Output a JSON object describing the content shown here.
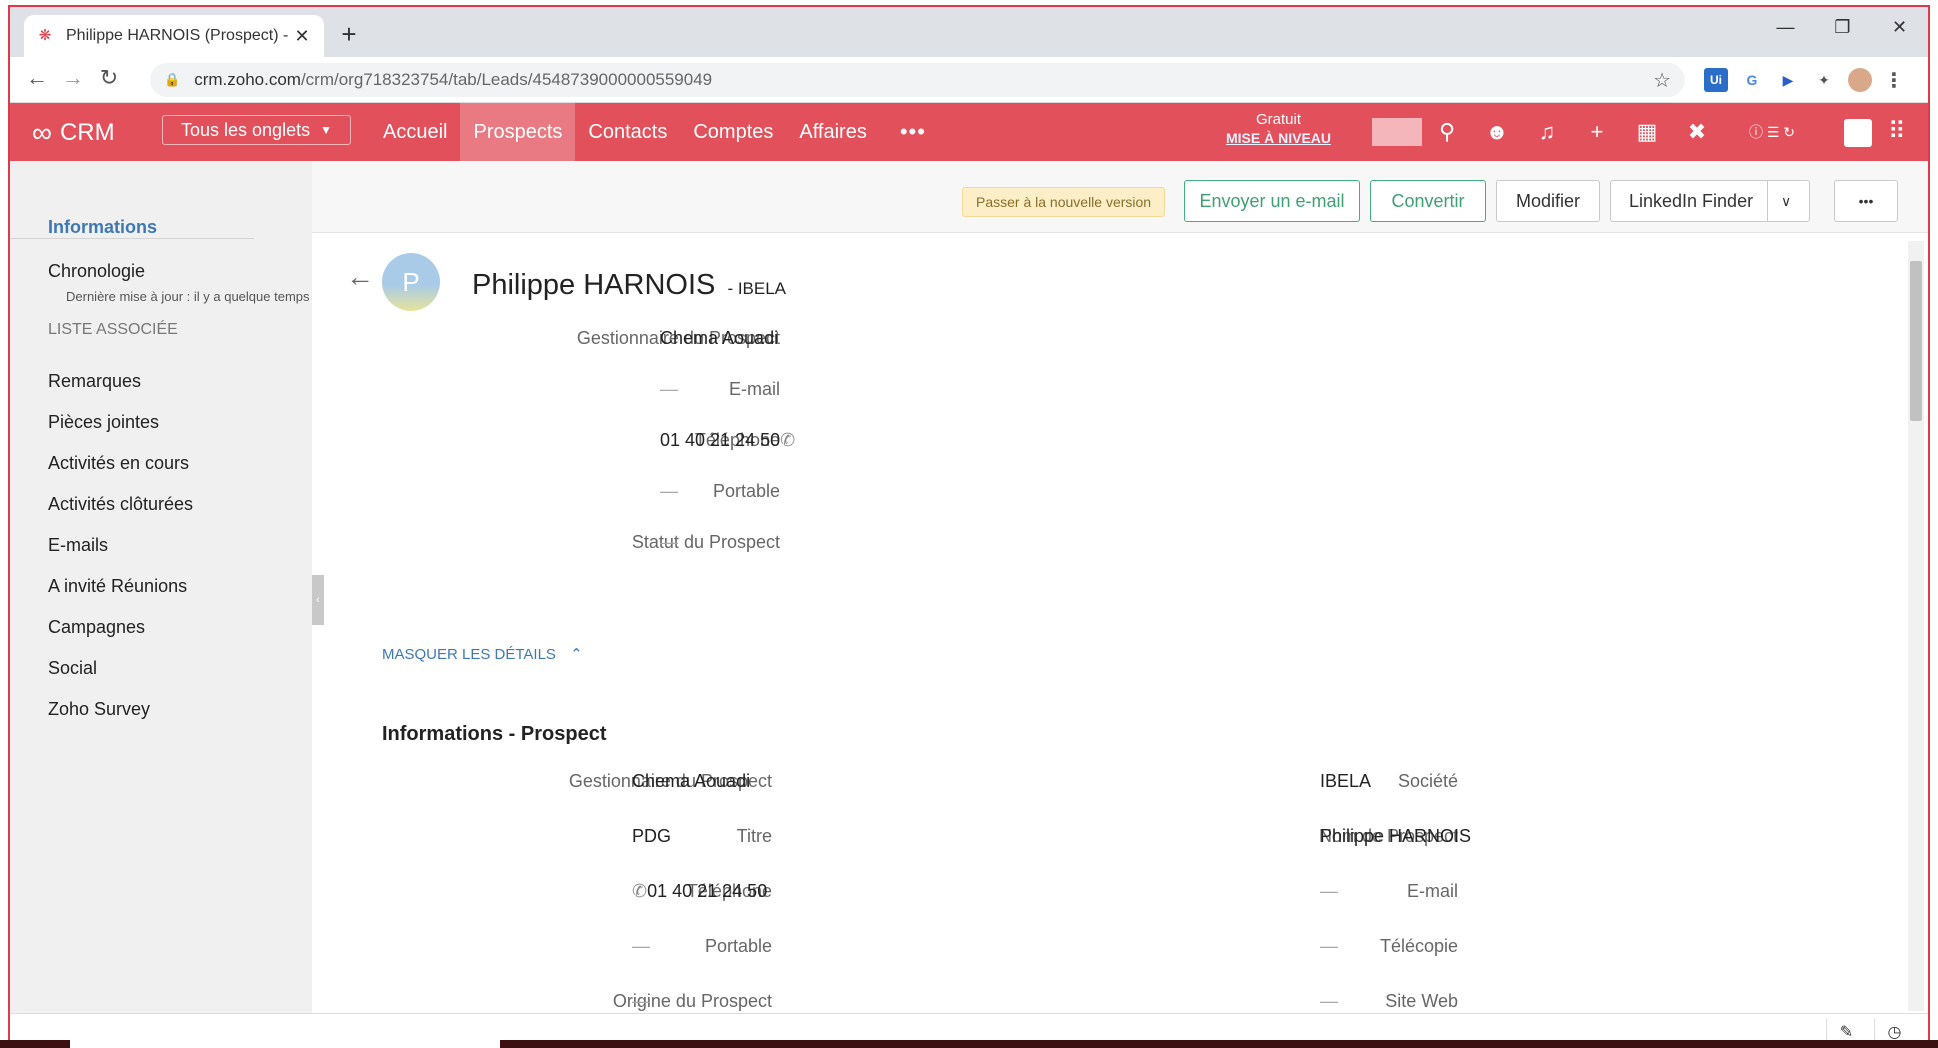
{
  "browser": {
    "tab_title": "Philippe HARNOIS (Prospect) - Zoho CRM",
    "url_host": "crm.zoho.com",
    "url_path": "/crm/org718323754/tab/Leads/4548739000000559049"
  },
  "crm": {
    "brand": "CRM",
    "all_tabs": "Tous les onglets",
    "nav": [
      "Accueil",
      "Prospects",
      "Contacts",
      "Comptes",
      "Affaires"
    ],
    "plan": "Gratuit",
    "upgrade": "MISE À NIVEAU"
  },
  "sidebar": {
    "informations": "Informations",
    "chronologie": "Chronologie",
    "chronologie_sub": "Dernière mise à jour : il y a quelque temps",
    "section": "LISTE ASSOCIÉE",
    "items": [
      "Remarques",
      "Pièces jointes",
      "Activités en cours",
      "Activités clôturées",
      "E-mails",
      "A invité Réunions",
      "Campagnes",
      "Social",
      "Zoho Survey"
    ]
  },
  "actions": {
    "badge": "Passer à la nouvelle version",
    "email": "Envoyer un e-mail",
    "convert": "Convertir",
    "edit": "Modifier",
    "linkedin": "LinkedIn Finder",
    "more": "•••"
  },
  "record": {
    "avatar_letter": "P",
    "name": "Philippe HARNOIS",
    "company_suffix": "- IBELA",
    "summary": [
      {
        "label": "Gestionnaire du Prospect",
        "value": "Chema Aouadi"
      },
      {
        "label": "E-mail",
        "value": "—"
      },
      {
        "label": "Téléphone",
        "value": "01 40 21 24 50"
      },
      {
        "label": "Portable",
        "value": "—"
      },
      {
        "label": "Statut du Prospect",
        "value": "—"
      }
    ],
    "toggle": "MASQUER LES DÉTAILS",
    "section_title": "Informations - Prospect",
    "left": [
      {
        "label": "Gestionnaire du Prospect",
        "value": "Chema Aouadi"
      },
      {
        "label": "Titre",
        "value": "PDG"
      },
      {
        "label": "Téléphone",
        "value": "01 40 21 24 50"
      },
      {
        "label": "Portable",
        "value": "—"
      },
      {
        "label": "Origine du Prospect",
        "value": "—"
      }
    ],
    "right": [
      {
        "label": "Société",
        "value": "IBELA"
      },
      {
        "label": "Nom de Prospect",
        "value": "Philippe HARNOIS"
      },
      {
        "label": "E-mail",
        "value": "—"
      },
      {
        "label": "Télécopie",
        "value": "—"
      },
      {
        "label": "Site Web",
        "value": "—"
      }
    ]
  }
}
